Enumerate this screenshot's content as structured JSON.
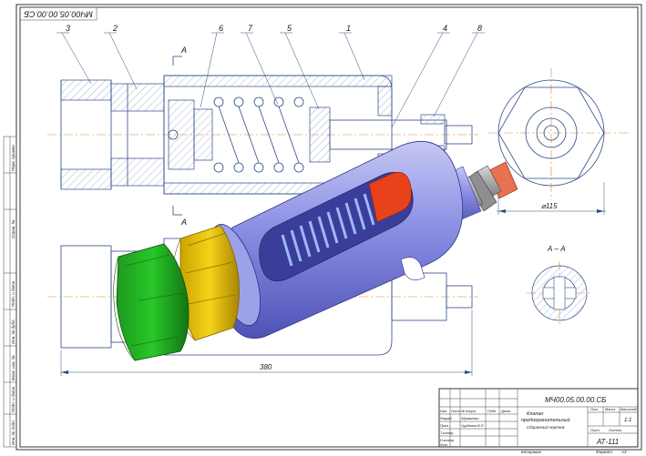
{
  "drawing": {
    "number_top_rotated": "МЧ00.05.00.00.СБ",
    "callouts": [
      "3",
      "2",
      "6",
      "7",
      "5",
      "1",
      "4",
      "8"
    ],
    "section_marker": "А",
    "section_title": "А – А",
    "dimension_length": "380",
    "dimension_diameter": "⌀115"
  },
  "side_strip": {
    "labels": [
      "Перв. примен.",
      "Справ. №",
      "Подп. и дата",
      "Инв. № дубл.",
      "Взам. инв. №",
      "Подп. и дата",
      "Инв. № подл."
    ]
  },
  "title_block": {
    "designation": "МЧ00.05.00.00.СБ",
    "name_line1": "Клапан",
    "name_line2": "предохранительный",
    "name_line3": "Сборочный чертеж",
    "scale": "1:1",
    "group": "АТ-111",
    "header_lit": "Лит.",
    "header_mass": "Масса",
    "header_scale": "Масштаб",
    "sheet_label": "Лист",
    "sheets_label": "Листов",
    "rows": [
      {
        "role": "Изм.",
        "c2": "Лист",
        "c3": "№ докум.",
        "c4": "Подп.",
        "c5": "Дата"
      },
      {
        "role": "Разраб.",
        "c2": "Абраменко",
        "c3": "",
        "c4": "",
        "c5": ""
      },
      {
        "role": "Пров.",
        "c2": "Чурбанов В.П.",
        "c3": "",
        "c4": "",
        "c5": ""
      },
      {
        "role": "Т.контр.",
        "c2": "",
        "c3": "",
        "c4": "",
        "c5": ""
      },
      {
        "role": "Н.контр.",
        "c2": "",
        "c3": "",
        "c4": "",
        "c5": ""
      },
      {
        "role": "Утв.",
        "c2": "",
        "c3": "",
        "c4": "",
        "c5": ""
      }
    ],
    "copied": "Копировал",
    "format": "Формат",
    "format_value": "А3"
  }
}
